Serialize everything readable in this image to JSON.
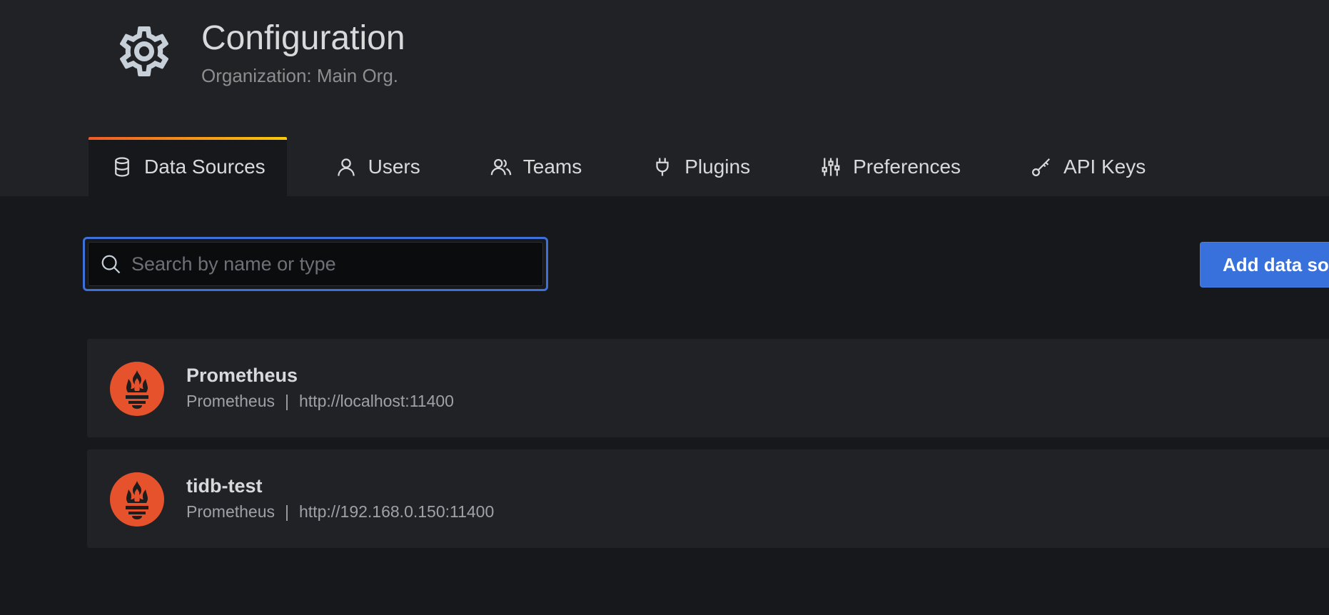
{
  "header": {
    "title": "Configuration",
    "subtitle": "Organization: Main Org.",
    "icon": "gear-icon"
  },
  "tabs": [
    {
      "label": "Data Sources",
      "icon": "database-icon",
      "active": true
    },
    {
      "label": "Users",
      "icon": "user-icon",
      "active": false
    },
    {
      "label": "Teams",
      "icon": "users-icon",
      "active": false
    },
    {
      "label": "Plugins",
      "icon": "plug-icon",
      "active": false
    },
    {
      "label": "Preferences",
      "icon": "sliders-icon",
      "active": false
    },
    {
      "label": "API Keys",
      "icon": "key-icon",
      "active": false
    }
  ],
  "search": {
    "placeholder": "Search by name or type",
    "value": ""
  },
  "actions": {
    "add_label": "Add data source"
  },
  "datasources": [
    {
      "name": "Prometheus",
      "type": "Prometheus",
      "separator": "|",
      "url": "http://localhost:11400",
      "icon": "prometheus-logo-icon"
    },
    {
      "name": "tidb-test",
      "type": "Prometheus",
      "separator": "|",
      "url": "http://192.168.0.150:11400",
      "icon": "prometheus-logo-icon"
    }
  ],
  "colors": {
    "accent_blue": "#3871dc",
    "tab_gradient_start": "#f05a28",
    "tab_gradient_end": "#fbca0a",
    "prometheus_orange": "#e6522c",
    "header_bg": "#202226",
    "page_bg": "#17181c"
  }
}
